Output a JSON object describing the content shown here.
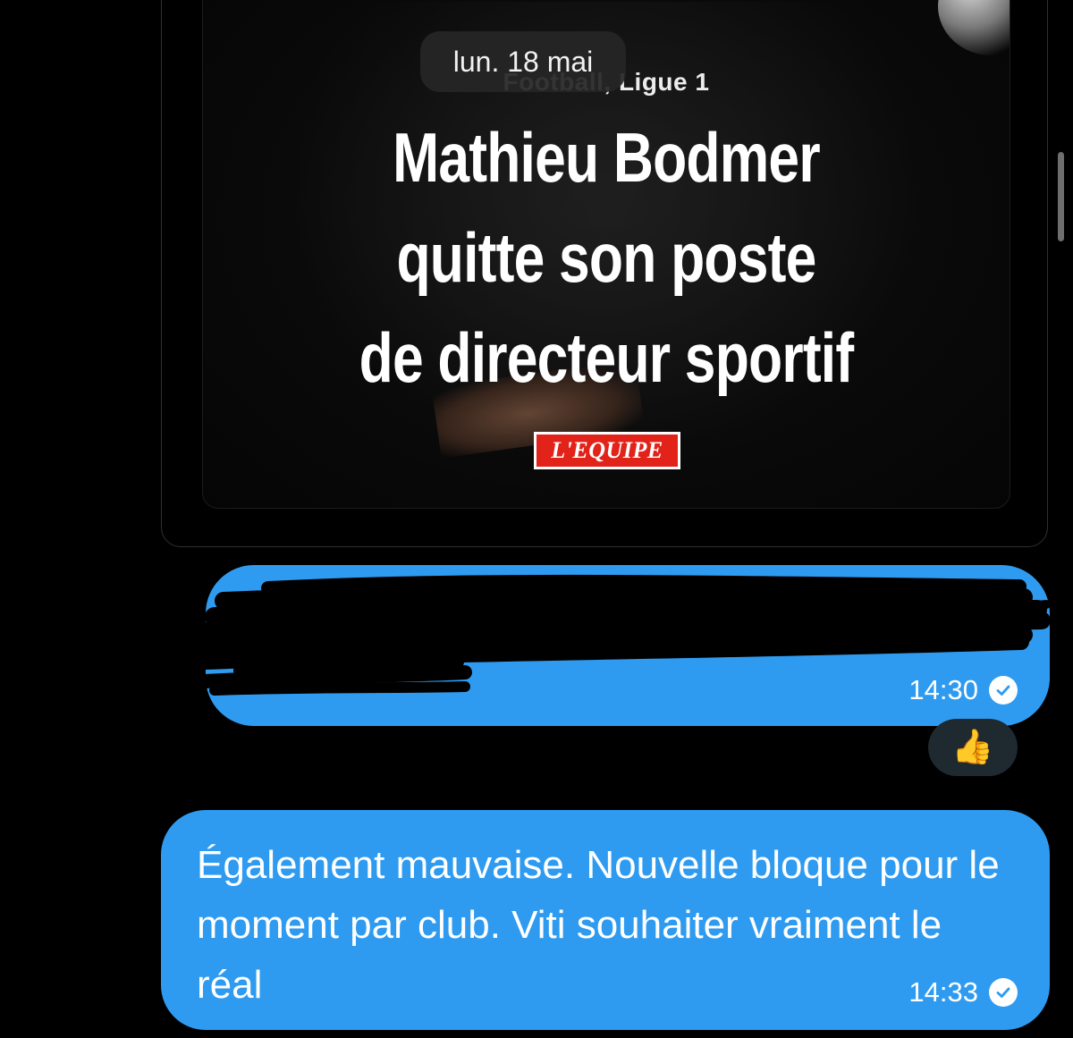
{
  "date_separator": "lun. 18 mai",
  "shared_post": {
    "kicker": "Football, Ligue 1",
    "headline_lines": [
      "Mathieu Bodmer",
      "quitte son poste",
      "de directeur sportif"
    ],
    "brand": "L'EQUIPE",
    "brand_color": "#e2231a"
  },
  "messages": [
    {
      "text": "",
      "redacted": true,
      "time": "14:30",
      "status": "read",
      "reaction": "👍"
    },
    {
      "text": "Également mauvaise. Nouvelle bloque pour le moment par club.  Viti souhaiter vraiment le réal",
      "redacted": false,
      "time": "14:33",
      "status": "read"
    }
  ],
  "colors": {
    "bubble": "#2f9bf0",
    "background": "#000000",
    "date_pill": "#262626"
  }
}
